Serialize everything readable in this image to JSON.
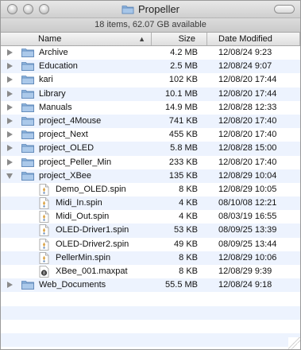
{
  "window": {
    "title": "Propeller",
    "status_text": "18 items, 62.07 GB available"
  },
  "columns": {
    "name": "Name",
    "size": "Size",
    "date": "Date Modified",
    "sort_indicator": "▲"
  },
  "items": [
    {
      "kind": "folder",
      "expanded": false,
      "name": "Archive",
      "size": "4.2 MB",
      "date": "12/08/24 9:23"
    },
    {
      "kind": "folder",
      "expanded": false,
      "name": "Education",
      "size": "2.5 MB",
      "date": "12/08/24 9:07"
    },
    {
      "kind": "folder",
      "expanded": false,
      "name": "kari",
      "size": "102 KB",
      "date": "12/08/20 17:44"
    },
    {
      "kind": "folder",
      "expanded": false,
      "name": "Library",
      "size": "10.1 MB",
      "date": "12/08/20 17:44"
    },
    {
      "kind": "folder",
      "expanded": false,
      "name": "Manuals",
      "size": "14.9 MB",
      "date": "12/08/28 12:33"
    },
    {
      "kind": "folder",
      "expanded": false,
      "name": "project_4Mouse",
      "size": "741 KB",
      "date": "12/08/20 17:40"
    },
    {
      "kind": "folder",
      "expanded": false,
      "name": "project_Next",
      "size": "455 KB",
      "date": "12/08/20 17:40"
    },
    {
      "kind": "folder",
      "expanded": false,
      "name": "project_OLED",
      "size": "5.8 MB",
      "date": "12/08/28 15:00"
    },
    {
      "kind": "folder",
      "expanded": false,
      "name": "project_Peller_Min",
      "size": "233 KB",
      "date": "12/08/20 17:40"
    },
    {
      "kind": "folder",
      "expanded": true,
      "name": "project_XBee",
      "size": "135 KB",
      "date": "12/08/29 10:04"
    },
    {
      "kind": "file",
      "name": "Demo_OLED.spin",
      "size": "8 KB",
      "date": "12/08/29 10:05"
    },
    {
      "kind": "file",
      "name": "Midi_In.spin",
      "size": "4 KB",
      "date": "08/10/08 12:21"
    },
    {
      "kind": "file",
      "name": "Midi_Out.spin",
      "size": "4 KB",
      "date": "08/03/19 16:55"
    },
    {
      "kind": "file",
      "name": "OLED-Driver1.spin",
      "size": "53 KB",
      "date": "08/09/25 13:39"
    },
    {
      "kind": "file",
      "name": "OLED-Driver2.spin",
      "size": "49 KB",
      "date": "08/09/25 13:44"
    },
    {
      "kind": "file",
      "name": "PellerMin.spin",
      "size": "8 KB",
      "date": "12/08/29 10:06"
    },
    {
      "kind": "maxpat",
      "name": "XBee_001.maxpat",
      "size": "8 KB",
      "date": "12/08/29 9:39"
    },
    {
      "kind": "folder",
      "expanded": false,
      "name": "Web_Documents",
      "size": "55.5 MB",
      "date": "12/08/24 9:18"
    }
  ],
  "empty_rows": 5,
  "colors": {
    "stripe": "#edf3fe",
    "folder": "#7fa9d8"
  }
}
